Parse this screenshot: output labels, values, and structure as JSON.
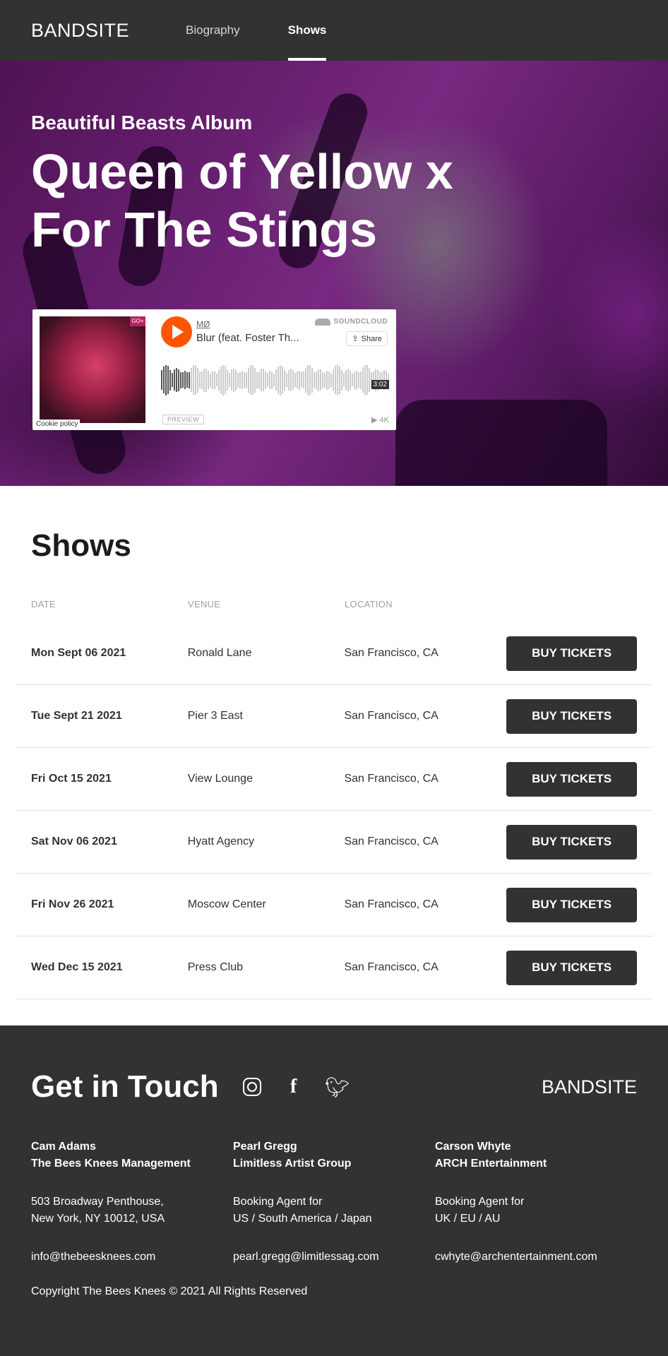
{
  "header": {
    "logo": "BANDSITE",
    "nav": [
      {
        "label": "Biography",
        "active": false
      },
      {
        "label": "Shows",
        "active": true
      }
    ]
  },
  "hero": {
    "subtitle": "Beautiful Beasts Album",
    "title": "Queen of Yellow x For The Stings",
    "player": {
      "artist": "MØ",
      "track": "Blur (feat. Foster Th...",
      "brand": "SOUNDCLOUD",
      "share": "Share",
      "time": "3:02",
      "preview": "PREVIEW",
      "plays": "4K",
      "cookie": "Cookie policy",
      "art_tag": "GO+"
    }
  },
  "shows": {
    "title": "Shows",
    "headers": {
      "date": "DATE",
      "venue": "VENUE",
      "location": "LOCATION"
    },
    "button_label": "BUY TICKETS",
    "rows": [
      {
        "date": "Mon Sept 06 2021",
        "venue": "Ronald Lane",
        "location": "San Francisco, CA"
      },
      {
        "date": "Tue Sept 21 2021",
        "venue": "Pier 3 East",
        "location": "San Francisco, CA"
      },
      {
        "date": "Fri Oct 15 2021",
        "venue": "View Lounge",
        "location": "San Francisco, CA"
      },
      {
        "date": "Sat Nov 06 2021",
        "venue": "Hyatt Agency",
        "location": "San Francisco, CA"
      },
      {
        "date": "Fri Nov 26 2021",
        "venue": "Moscow Center",
        "location": "San Francisco, CA"
      },
      {
        "date": "Wed Dec 15 2021",
        "venue": "Press Club",
        "location": "San Francisco, CA"
      }
    ]
  },
  "footer": {
    "title": "Get in Touch",
    "logo": "BANDSITE",
    "social_icons": [
      "instagram-icon",
      "facebook-icon",
      "twitter-icon"
    ],
    "contacts": [
      {
        "name": "Cam Adams",
        "company": "The Bees Knees Management",
        "line1": "503 Broadway Penthouse,",
        "line2": "New York, NY 10012, USA",
        "email": "info@thebeesknees.com"
      },
      {
        "name": "Pearl Gregg",
        "company": "Limitless Artist Group",
        "line1": "Booking Agent for",
        "line2": "US / South America / Japan",
        "email": "pearl.gregg@limitlessag.com"
      },
      {
        "name": "Carson Whyte",
        "company": "ARCH Entertainment",
        "line1": "Booking Agent for",
        "line2": "UK / EU / AU",
        "email": "cwhyte@archentertainment.com"
      }
    ],
    "copyright": "Copyright The Bees Knees © 2021 All Rights Reserved"
  },
  "colors": {
    "dark": "#323232",
    "soundcloud": "#ff5500",
    "divider": "#e1e1e1"
  }
}
